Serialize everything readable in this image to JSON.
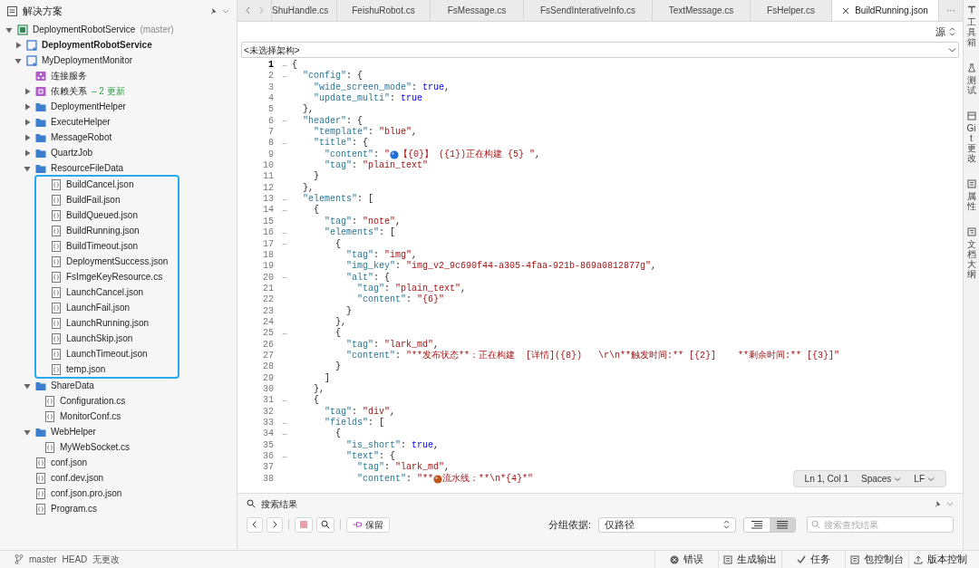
{
  "sidebar": {
    "title": "解决方案",
    "tree": [
      {
        "kind": "solution",
        "name": "DeploymentRobotService",
        "suffix": "(master)",
        "expanded": true,
        "children": [
          {
            "kind": "project",
            "name": "DeploymentRobotService",
            "startup": true,
            "expanded": false
          },
          {
            "kind": "project",
            "name": "MyDeploymentMonitor",
            "startup": false,
            "expanded": true,
            "children": [
              {
                "kind": "service",
                "name": "连接服务"
              },
              {
                "kind": "dependency",
                "name": "依赖关系",
                "badge": "– 2 更新",
                "expanded": false
              },
              {
                "kind": "folder",
                "name": "DeploymentHelper",
                "expanded": false
              },
              {
                "kind": "folder",
                "name": "ExecuteHelper",
                "expanded": false
              },
              {
                "kind": "folder",
                "name": "MessageRobot",
                "expanded": false
              },
              {
                "kind": "folder",
                "name": "QuartzJob",
                "expanded": false
              },
              {
                "kind": "folder",
                "name": "ResourceFileData",
                "expanded": true,
                "highlight_box": true,
                "children": [
                  {
                    "kind": "file",
                    "name": "BuildCancel.json"
                  },
                  {
                    "kind": "file",
                    "name": "BuildFail.json"
                  },
                  {
                    "kind": "file",
                    "name": "BuildQueued.json"
                  },
                  {
                    "kind": "file",
                    "name": "BuildRunning.json"
                  },
                  {
                    "kind": "file",
                    "name": "BuildTimeout.json"
                  },
                  {
                    "kind": "file",
                    "name": "DeploymentSuccess.json"
                  },
                  {
                    "kind": "file",
                    "name": "FsImgeKeyResource.cs"
                  },
                  {
                    "kind": "file",
                    "name": "LaunchCancel.json"
                  },
                  {
                    "kind": "file",
                    "name": "LaunchFail.json"
                  },
                  {
                    "kind": "file",
                    "name": "LaunchRunning.json"
                  },
                  {
                    "kind": "file",
                    "name": "LaunchSkip.json"
                  },
                  {
                    "kind": "file",
                    "name": "LaunchTimeout.json"
                  },
                  {
                    "kind": "file",
                    "name": "temp.json"
                  }
                ]
              },
              {
                "kind": "folder",
                "name": "ShareData",
                "expanded": true,
                "children": [
                  {
                    "kind": "file",
                    "name": "Configuration.cs"
                  },
                  {
                    "kind": "file",
                    "name": "MonitorConf.cs"
                  }
                ]
              },
              {
                "kind": "folder",
                "name": "WebHelper",
                "expanded": true,
                "children": [
                  {
                    "kind": "file",
                    "name": "MyWebSocket.cs"
                  }
                ]
              },
              {
                "kind": "file",
                "name": "conf.json"
              },
              {
                "kind": "file",
                "name": "conf.dev.json"
              },
              {
                "kind": "file",
                "name": "conf.json.pro.json"
              },
              {
                "kind": "file",
                "name": "Program.cs"
              }
            ]
          }
        ]
      }
    ]
  },
  "tabs": [
    {
      "label": "ShuHandle.cs",
      "selected": false
    },
    {
      "label": "FeishuRobot.cs",
      "selected": false
    },
    {
      "label": "FsMessage.cs",
      "selected": false
    },
    {
      "label": "FsSendInterativeInfo.cs",
      "selected": false
    },
    {
      "label": "TextMessage.cs",
      "selected": false
    },
    {
      "label": "FsHelper.cs",
      "selected": false
    },
    {
      "label": "BuildRunning.json",
      "selected": true
    }
  ],
  "tab_overflow": "···",
  "view_mode": "源",
  "architecture": "<未选择架构>",
  "code": [
    {
      "number": "1",
      "fold": true,
      "current": true,
      "tokens": [
        {
          "kind": "punct",
          "text": "{"
        }
      ]
    },
    {
      "number": "2",
      "fold": true,
      "current": false,
      "tokens": [
        {
          "kind": "key",
          "text": "  \"config\""
        },
        {
          "kind": "punct",
          "text": ": {"
        }
      ]
    },
    {
      "number": "3",
      "fold": false,
      "current": false,
      "tokens": [
        {
          "kind": "key",
          "text": "    \"wide_screen_mode\""
        },
        {
          "kind": "punct",
          "text": ": "
        },
        {
          "kind": "bool",
          "text": "true"
        },
        {
          "kind": "punct",
          "text": ","
        }
      ]
    },
    {
      "number": "4",
      "fold": false,
      "current": false,
      "tokens": [
        {
          "kind": "key",
          "text": "    \"update_multi\""
        },
        {
          "kind": "punct",
          "text": ": "
        },
        {
          "kind": "bool",
          "text": "true"
        }
      ]
    },
    {
      "number": "5",
      "fold": false,
      "current": false,
      "tokens": [
        {
          "kind": "punct",
          "text": "  },"
        }
      ]
    },
    {
      "number": "6",
      "fold": true,
      "current": false,
      "tokens": [
        {
          "kind": "key",
          "text": "  \"header\""
        },
        {
          "kind": "punct",
          "text": ": {"
        }
      ]
    },
    {
      "number": "7",
      "fold": false,
      "current": false,
      "tokens": [
        {
          "kind": "key",
          "text": "    \"template\""
        },
        {
          "kind": "punct",
          "text": ": "
        },
        {
          "kind": "string",
          "text": "\"blue\""
        },
        {
          "kind": "punct",
          "text": ","
        }
      ]
    },
    {
      "number": "8",
      "fold": true,
      "current": false,
      "tokens": [
        {
          "kind": "key",
          "text": "    \"title\""
        },
        {
          "kind": "punct",
          "text": ": {"
        }
      ]
    },
    {
      "number": "9",
      "fold": false,
      "current": false,
      "tokens": [
        {
          "kind": "key",
          "text": "      \"content\""
        },
        {
          "kind": "punct",
          "text": ": "
        },
        {
          "kind": "string",
          "text": "\""
        },
        {
          "kind": "emoji",
          "color": "#1f6fd6"
        },
        {
          "kind": "string",
          "text": "【{0}】 ({1})正在构建 {5} \""
        },
        {
          "kind": "punct",
          "text": ","
        }
      ]
    },
    {
      "number": "10",
      "fold": false,
      "current": false,
      "tokens": [
        {
          "kind": "key",
          "text": "      \"tag\""
        },
        {
          "kind": "punct",
          "text": ": "
        },
        {
          "kind": "string",
          "text": "\"plain_text\""
        }
      ]
    },
    {
      "number": "11",
      "fold": false,
      "current": false,
      "tokens": [
        {
          "kind": "punct",
          "text": "    }"
        }
      ]
    },
    {
      "number": "12",
      "fold": false,
      "current": false,
      "tokens": [
        {
          "kind": "punct",
          "text": "  },"
        }
      ]
    },
    {
      "number": "13",
      "fold": true,
      "current": false,
      "tokens": [
        {
          "kind": "key",
          "text": "  \"elements\""
        },
        {
          "kind": "punct",
          "text": ": ["
        }
      ]
    },
    {
      "number": "14",
      "fold": true,
      "current": false,
      "tokens": [
        {
          "kind": "punct",
          "text": "    {"
        }
      ]
    },
    {
      "number": "15",
      "fold": false,
      "current": false,
      "tokens": [
        {
          "kind": "key",
          "text": "      \"tag\""
        },
        {
          "kind": "punct",
          "text": ": "
        },
        {
          "kind": "string",
          "text": "\"note\""
        },
        {
          "kind": "punct",
          "text": ","
        }
      ]
    },
    {
      "number": "16",
      "fold": true,
      "current": false,
      "tokens": [
        {
          "kind": "key",
          "text": "      \"elements\""
        },
        {
          "kind": "punct",
          "text": ": ["
        }
      ]
    },
    {
      "number": "17",
      "fold": true,
      "current": false,
      "tokens": [
        {
          "kind": "punct",
          "text": "        {"
        }
      ]
    },
    {
      "number": "18",
      "fold": false,
      "current": false,
      "tokens": [
        {
          "kind": "key",
          "text": "          \"tag\""
        },
        {
          "kind": "punct",
          "text": ": "
        },
        {
          "kind": "string",
          "text": "\"img\""
        },
        {
          "kind": "punct",
          "text": ","
        }
      ]
    },
    {
      "number": "19",
      "fold": false,
      "current": false,
      "tokens": [
        {
          "kind": "key",
          "text": "          \"img_key\""
        },
        {
          "kind": "punct",
          "text": ": "
        },
        {
          "kind": "string",
          "text": "\"img_v2_9c690f44-a305-4faa-921b-869a0812877g\""
        },
        {
          "kind": "punct",
          "text": ","
        }
      ]
    },
    {
      "number": "20",
      "fold": true,
      "current": false,
      "tokens": [
        {
          "kind": "key",
          "text": "          \"alt\""
        },
        {
          "kind": "punct",
          "text": ": {"
        }
      ]
    },
    {
      "number": "21",
      "fold": false,
      "current": false,
      "tokens": [
        {
          "kind": "key",
          "text": "            \"tag\""
        },
        {
          "kind": "punct",
          "text": ": "
        },
        {
          "kind": "string",
          "text": "\"plain_text\""
        },
        {
          "kind": "punct",
          "text": ","
        }
      ]
    },
    {
      "number": "22",
      "fold": false,
      "current": false,
      "tokens": [
        {
          "kind": "key",
          "text": "            \"content\""
        },
        {
          "kind": "punct",
          "text": ": "
        },
        {
          "kind": "string",
          "text": "\"{6}\""
        }
      ]
    },
    {
      "number": "23",
      "fold": false,
      "current": false,
      "tokens": [
        {
          "kind": "punct",
          "text": "          }"
        }
      ]
    },
    {
      "number": "24",
      "fold": false,
      "current": false,
      "tokens": [
        {
          "kind": "punct",
          "text": "        },"
        }
      ]
    },
    {
      "number": "25",
      "fold": true,
      "current": false,
      "tokens": [
        {
          "kind": "punct",
          "text": "        {"
        }
      ]
    },
    {
      "number": "26",
      "fold": false,
      "current": false,
      "tokens": [
        {
          "kind": "key",
          "text": "          \"tag\""
        },
        {
          "kind": "punct",
          "text": ": "
        },
        {
          "kind": "string",
          "text": "\"lark_md\""
        },
        {
          "kind": "punct",
          "text": ","
        }
      ]
    },
    {
      "number": "27",
      "fold": false,
      "current": false,
      "tokens": [
        {
          "kind": "key",
          "text": "          \"content\""
        },
        {
          "kind": "punct",
          "text": ": "
        },
        {
          "kind": "string",
          "text": "\"**发布状态**：正在构建  [详情]({8})   \\r\\n**触发时间:** [{2}]    **剩余时间:** [{3}]\""
        }
      ]
    },
    {
      "number": "28",
      "fold": false,
      "current": false,
      "tokens": [
        {
          "kind": "punct",
          "text": "        }"
        }
      ]
    },
    {
      "number": "29",
      "fold": false,
      "current": false,
      "tokens": [
        {
          "kind": "punct",
          "text": "      ]"
        }
      ]
    },
    {
      "number": "30",
      "fold": false,
      "current": false,
      "tokens": [
        {
          "kind": "punct",
          "text": "    },"
        }
      ]
    },
    {
      "number": "31",
      "fold": true,
      "current": false,
      "tokens": [
        {
          "kind": "punct",
          "text": "    {"
        }
      ]
    },
    {
      "number": "32",
      "fold": false,
      "current": false,
      "tokens": [
        {
          "kind": "key",
          "text": "      \"tag\""
        },
        {
          "kind": "punct",
          "text": ": "
        },
        {
          "kind": "string",
          "text": "\"div\""
        },
        {
          "kind": "punct",
          "text": ","
        }
      ]
    },
    {
      "number": "33",
      "fold": true,
      "current": false,
      "tokens": [
        {
          "kind": "key",
          "text": "      \"fields\""
        },
        {
          "kind": "punct",
          "text": ": ["
        }
      ]
    },
    {
      "number": "34",
      "fold": true,
      "current": false,
      "tokens": [
        {
          "kind": "punct",
          "text": "        {"
        }
      ]
    },
    {
      "number": "35",
      "fold": false,
      "current": false,
      "tokens": [
        {
          "kind": "key",
          "text": "          \"is_short\""
        },
        {
          "kind": "punct",
          "text": ": "
        },
        {
          "kind": "bool",
          "text": "true"
        },
        {
          "kind": "punct",
          "text": ","
        }
      ]
    },
    {
      "number": "36",
      "fold": true,
      "current": false,
      "tokens": [
        {
          "kind": "key",
          "text": "          \"text\""
        },
        {
          "kind": "punct",
          "text": ": {"
        }
      ]
    },
    {
      "number": "37",
      "fold": false,
      "current": false,
      "tokens": [
        {
          "kind": "key",
          "text": "            \"tag\""
        },
        {
          "kind": "punct",
          "text": ": "
        },
        {
          "kind": "string",
          "text": "\"lark_md\""
        },
        {
          "kind": "punct",
          "text": ","
        }
      ]
    },
    {
      "number": "38",
      "fold": false,
      "current": false,
      "tokens": [
        {
          "kind": "key",
          "text": "            \"content\""
        },
        {
          "kind": "punct",
          "text": ": "
        },
        {
          "kind": "string",
          "text": "\"**"
        },
        {
          "kind": "emoji",
          "color": "#c0561e"
        },
        {
          "kind": "string",
          "text": "流水线：**\\n*{4}*\""
        }
      ]
    }
  ],
  "editor_status": {
    "position": "Ln 1, Col 1",
    "indentation": "Spaces",
    "line_ending": "LF"
  },
  "search_panel": {
    "title": "搜索结果",
    "keep_button": "保留",
    "group_label": "分组依据:",
    "group_value": "仅路径",
    "views": [
      {
        "kind": "tree",
        "selected": false
      },
      {
        "kind": "flat",
        "selected": true
      }
    ],
    "filter_placeholder": "搜索查找结果"
  },
  "right_rail": [
    {
      "kind": "toolbox",
      "label": "工具箱"
    },
    {
      "kind": "test",
      "label": "测试"
    },
    {
      "kind": "git",
      "label": "Git 更改"
    },
    {
      "kind": "properties",
      "label": "属性"
    },
    {
      "kind": "outline",
      "label": "文档大纲"
    }
  ],
  "status_bar": {
    "branch": "master",
    "head": "HEAD",
    "changes": "无更改",
    "pads": [
      {
        "kind": "errors",
        "label": "错误"
      },
      {
        "kind": "output",
        "label": "生成输出"
      },
      {
        "kind": "tasks",
        "label": "任务"
      },
      {
        "kind": "console",
        "label": "包控制台"
      },
      {
        "kind": "vcs",
        "label": "版本控制"
      }
    ]
  }
}
